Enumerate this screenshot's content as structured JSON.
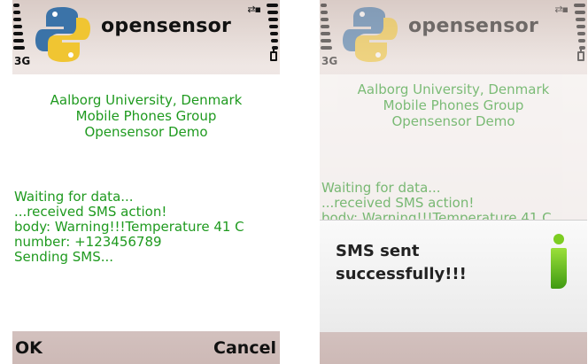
{
  "app_title": "opensensor",
  "network": "3G",
  "icons": {
    "logo": "python-logo-icon",
    "signal": "signal-strength-icon",
    "battery": "battery-icon",
    "connection": "connection-icon",
    "info": "info-icon"
  },
  "colors": {
    "content_text": "#1f9a1f",
    "info_icon": "#6cc41e"
  },
  "phones": {
    "left": {
      "header": [
        "Aalborg University, Denmark",
        "Mobile Phones Group",
        "Opensensor Demo"
      ],
      "log": [
        "Waiting for data...",
        "...received SMS action!",
        "body: Warning!!!Temperature 41 C",
        "number: +123456789",
        "Sending SMS..."
      ],
      "softkeys": {
        "left": "OK",
        "right": "Cancel"
      }
    },
    "right": {
      "header": [
        "Aalborg University, Denmark",
        "Mobile Phones Group",
        "Opensensor Demo"
      ],
      "log": [
        "Waiting for data...",
        "...received SMS action!",
        "body: Warning!!!Temperature 41 C"
      ],
      "note": {
        "line1": "SMS sent",
        "line2": "successfully!!!"
      }
    }
  }
}
